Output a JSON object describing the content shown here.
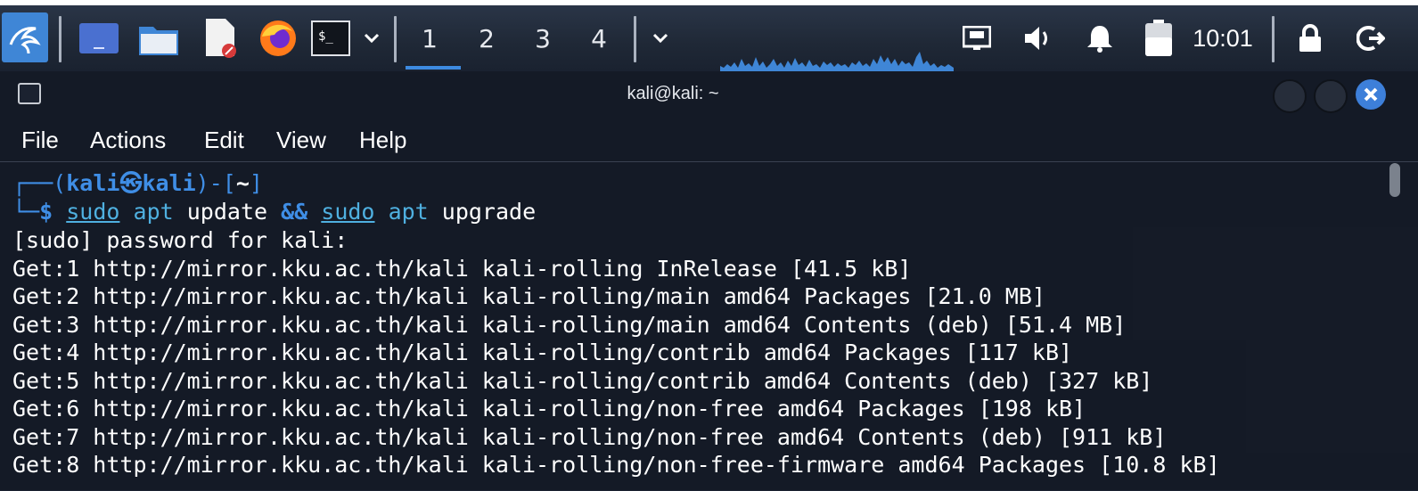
{
  "taskbar": {
    "workspaces": [
      "1",
      "2",
      "3",
      "4"
    ],
    "active_workspace": "1",
    "clock": "10:01",
    "icons": [
      "kali-menu-icon",
      "show-desktop-icon",
      "files-icon",
      "text-editor-icon",
      "firefox-icon",
      "terminal-icon",
      "chevron-down-icon",
      "chevron-down-icon",
      "network-icon",
      "volume-icon",
      "notifications-icon",
      "battery-icon",
      "lock-icon",
      "logout-icon"
    ]
  },
  "window": {
    "title": "kali@kali: ~",
    "close_color": "#3d7fd9"
  },
  "menu": [
    "File",
    "Actions",
    "Edit",
    "View",
    "Help"
  ],
  "terminal": {
    "prompt": {
      "corner_top": "┌──(",
      "user": "kali",
      "at_symbol": "㉿",
      "host": "kali",
      "bracket_mid": ")-[",
      "path": "~",
      "bracket_end": "]",
      "corner_bottom": "└─",
      "dollar": "$",
      "cmd1": "sudo",
      "cmd1b": "apt",
      "cmd1c": "update",
      "op": "&&",
      "cmd2": "sudo",
      "cmd2b": "apt",
      "cmd2c": "upgrade"
    },
    "output": [
      "[sudo] password for kali:",
      "Get:1 http://mirror.kku.ac.th/kali kali-rolling InRelease [41.5 kB]",
      "Get:2 http://mirror.kku.ac.th/kali kali-rolling/main amd64 Packages [21.0 MB]",
      "Get:3 http://mirror.kku.ac.th/kali kali-rolling/main amd64 Contents (deb) [51.4 MB]",
      "Get:4 http://mirror.kku.ac.th/kali kali-rolling/contrib amd64 Packages [117 kB]",
      "Get:5 http://mirror.kku.ac.th/kali kali-rolling/contrib amd64 Contents (deb) [327 kB]",
      "Get:6 http://mirror.kku.ac.th/kali kali-rolling/non-free amd64 Packages [198 kB]",
      "Get:7 http://mirror.kku.ac.th/kali kali-rolling/non-free amd64 Contents (deb) [911 kB]",
      "Get:8 http://mirror.kku.ac.th/kali kali-rolling/non-free-firmware amd64 Packages [10.8 kB]"
    ]
  },
  "colors": {
    "accent": "#3f8ee6",
    "terminal_bg": "#141a26",
    "text": "#ffffff"
  }
}
